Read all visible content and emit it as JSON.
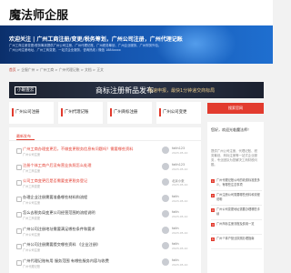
{
  "site": {
    "logo": "魔法师企服"
  },
  "hero": {
    "title": "欢迎关注 | 广州工商注册/变更/税务筹划，广州公司注册，广州代理记账",
    "desc": "广州工商注册变更/税务筹划提供广州公司注册、广州代理记账、广州税务筹划、广州企业服务、广州财务外包、广州公司注册地址、广州工商变更、一站式企业服务，咨询热线 / 微信 1884xxxx"
  },
  "breadcrumb": {
    "home": "首页",
    "path": " > 企服广州 > 广州工商 > 广州代理记账 > 文档 > 正文"
  },
  "banner": {
    "logo": "小眼壹云",
    "main": "商标注册新品发布",
    "sub": "极速申报，最快1分钟递交商标局"
  },
  "tiles": [
    {
      "label": "广州公司注册"
    },
    {
      "label": "广州代理记账"
    },
    {
      "label": "广州商标注册"
    },
    {
      "label": "广州公司变更"
    }
  ],
  "sidebar": {
    "button": "搜索官网",
    "hello": "您好，欢迎光临魔法师！",
    "text": "提供广州公司注册、代理记账、税务筹划、商标注册等一站式企业服务，专业团队为您解决工商财税问题。",
    "links": [
      {
        "num": "1",
        "text": "广州代理记账公司的收费标准是多少，有哪些注意事项"
      },
      {
        "num": "2",
        "text": "广州注册公司需要哪些资料和流程说明"
      },
      {
        "num": "3",
        "text": "广州公司变更地址需要办理哪些手续"
      },
      {
        "num": "4",
        "text": "广州商标注册流程及费用一览"
      },
      {
        "num": "5",
        "text": "广州个体户营业执照办理指南"
      }
    ]
  },
  "list": {
    "heading": "最新发布",
    "rows": [
      {
        "title": "广州工商办理变更后，不做变更税务信息有问题吗？需要哪些资料",
        "meta": "广州公司注册",
        "user": "faith123",
        "time": "2023-05-10",
        "color": "red"
      },
      {
        "title": "注册个体工商户后没有营业执照怎么处理",
        "meta": "广州工商注册",
        "user": "faith123",
        "time": "2023-05-10",
        "color": "red"
      },
      {
        "title": "公司工商变更后是否需要变更税务登记",
        "meta": "广州工商变更",
        "user": "北京小张",
        "time": "2023-05-10",
        "color": "red"
      },
      {
        "title": "办理企业注册需要准备哪些材料和流程",
        "meta": "广州公司注册",
        "user": "faith",
        "time": "2023-05-10",
        "color": "dark"
      },
      {
        "title": "怎么去税务局变更公司经营范围的流程说明",
        "meta": "广州工商变更",
        "user": "faith",
        "time": "2023-05-10",
        "color": "dark"
      },
      {
        "title": "广州公司注册地址需要满足哪些条件和要求",
        "meta": "广州公司注册",
        "user": "faith",
        "time": "2023-05-10",
        "color": "dark"
      },
      {
        "title": "广州公司注册需要提交哪些资料 《企业注册》",
        "meta": "广州公司注册",
        "user": "faith",
        "time": "2023-05-10",
        "color": "dark"
      },
      {
        "title": "广州代理记账有用 服务范围 有哪些服务内容与收费",
        "meta": "广州代理记账",
        "user": "faith",
        "time": "2023-05-10",
        "color": "dark"
      }
    ]
  }
}
